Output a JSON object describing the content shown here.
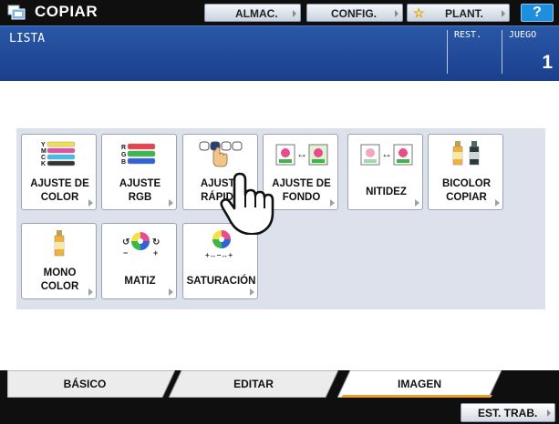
{
  "app": {
    "title": "COPIAR",
    "icon": "copier-icon"
  },
  "toolbar": {
    "almac_label": "ALMAC.",
    "config_label": "CONFIG.",
    "plant_label": "PLANT.",
    "help_label": "?"
  },
  "header": {
    "mode": "LISTA",
    "rest_label": "REST.",
    "juego_label": "JUEGO",
    "copies": "1"
  },
  "functions": [
    {
      "label": "AJUSTE DE\nCOLOR",
      "icon": "color-balance-icon"
    },
    {
      "label": "AJUSTE\nRGB",
      "icon": "rgb-adjust-icon"
    },
    {
      "label": "AJUSTE\nRÁPIDO",
      "icon": "one-touch-adjust-icon"
    },
    {
      "label": "AJUSTE DE\nFONDO",
      "icon": "background-adjust-icon"
    },
    {
      "label": "NITIDEZ",
      "icon": "sharpness-icon"
    },
    {
      "label": "BICOLOR\nCOPIAR",
      "icon": "twin-color-icon"
    },
    {
      "label": "MONO\nCOLOR",
      "icon": "mono-color-icon"
    },
    {
      "label": "MATIZ",
      "icon": "hue-icon"
    },
    {
      "label": "SATURACIÓN",
      "icon": "saturation-icon"
    }
  ],
  "tabs": [
    {
      "label": "BÁSICO",
      "active": false
    },
    {
      "label": "EDITAR",
      "active": false
    },
    {
      "label": "IMAGEN",
      "active": true
    }
  ],
  "footer": {
    "est_trab_label": "EST. TRAB."
  },
  "colors": {
    "header_blue": "#2a57a8",
    "active_tab_accent": "#f0a020",
    "help_blue": "#1e8fe0",
    "panel_bg": "#dde1ec"
  }
}
